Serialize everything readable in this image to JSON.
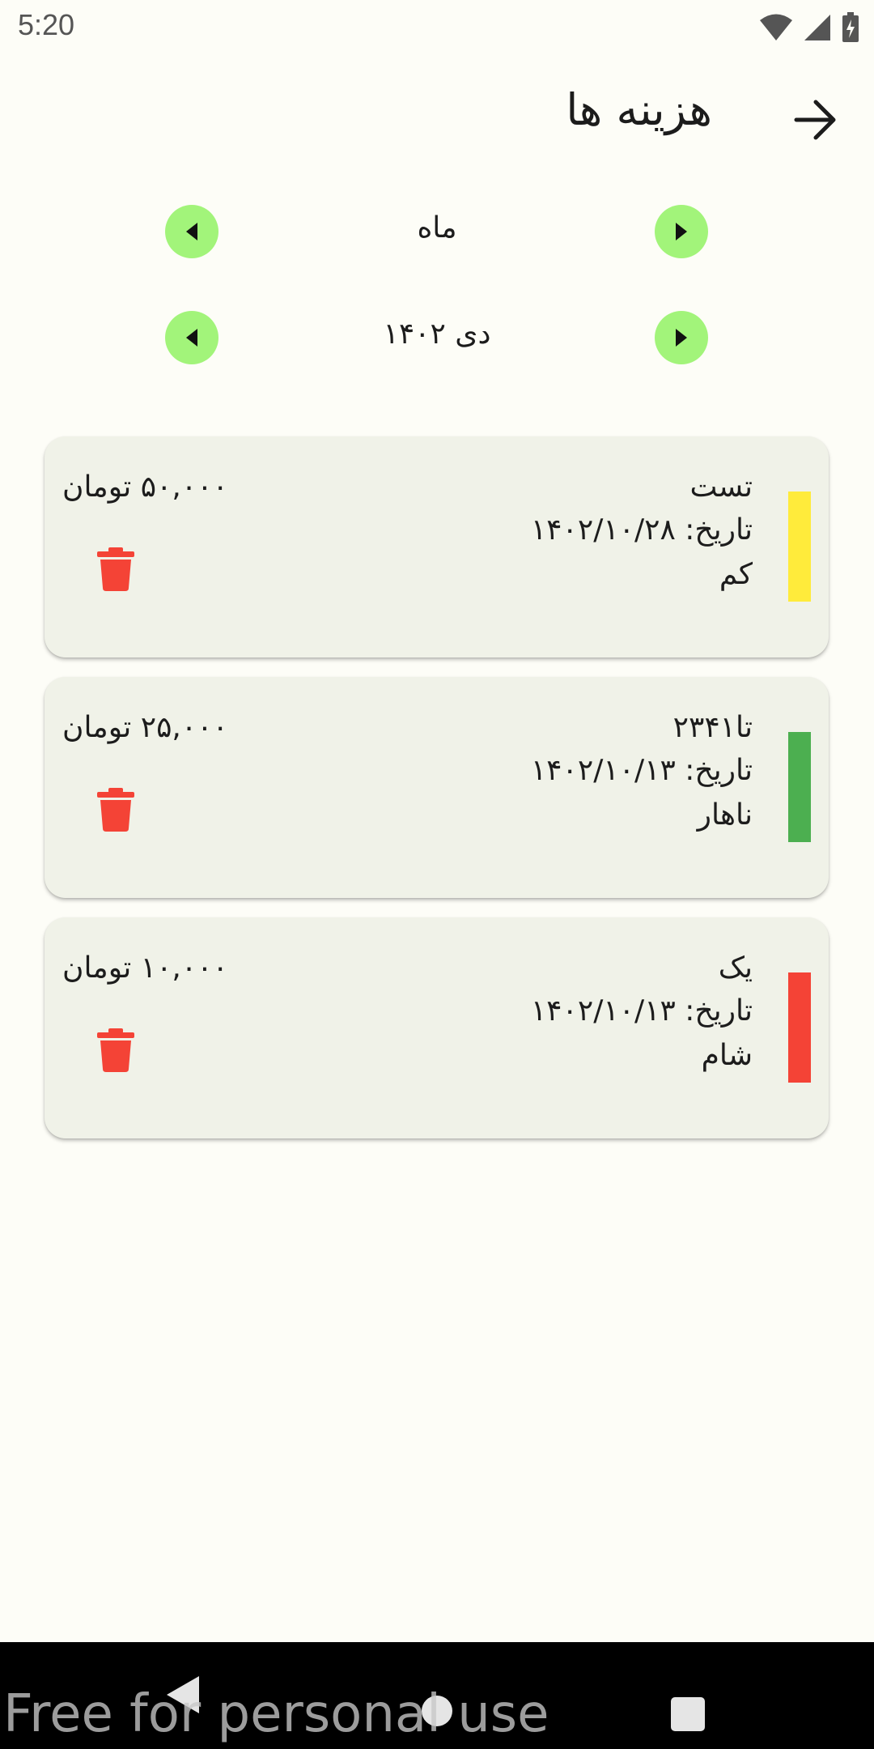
{
  "status_bar": {
    "time": "5:20"
  },
  "header": {
    "title": "هزینه ها"
  },
  "period_selector": {
    "label": "ماه"
  },
  "date_selector": {
    "label": "دی ۱۴۰۲"
  },
  "expenses": [
    {
      "title": "تست",
      "date": "تاریخ: ۱۴۰۲/۱۰/۲۸",
      "category": "کم",
      "amount": "۵۰,۰۰۰ تومان",
      "color": "#ffeb3b"
    },
    {
      "title": "تا۲۳۴۱",
      "date": "تاریخ: ۱۴۰۲/۱۰/۱۳",
      "category": "ناهار",
      "amount": "۲۵,۰۰۰ تومان",
      "color": "#4caf50"
    },
    {
      "title": "یک",
      "date": "تاریخ: ۱۴۰۲/۱۰/۱۳",
      "category": "شام",
      "amount": "۱۰,۰۰۰ تومان",
      "color": "#f44336"
    }
  ],
  "watermark": "Free for personal use",
  "colors": {
    "accent_button": "#a2f47a",
    "delete": "#f44336",
    "card_bg": "#f0f2e8",
    "page_bg": "#fdfdf7"
  }
}
